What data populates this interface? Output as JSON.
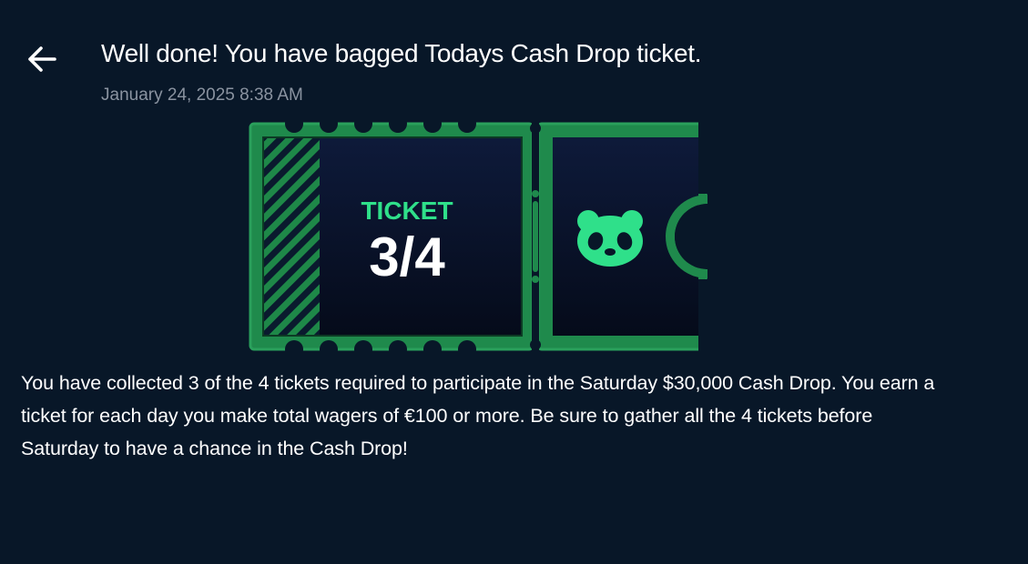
{
  "header": {
    "back_icon": "arrow-left-icon",
    "title": "Well done! You have bagged Todays Cash Drop ticket.",
    "timestamp": "January 24, 2025 8:38 AM"
  },
  "ticket": {
    "label": "TICKET",
    "progress": "3/4",
    "collected": 3,
    "required": 4,
    "mascot_icon": "panda-icon",
    "colors": {
      "frame": "#1f8a4c",
      "accent": "#2fe08a",
      "inner": "#0a1430"
    }
  },
  "message": {
    "body": "You have collected 3 of the 4 tickets required to participate in the Saturday $30,000 Cash Drop. You earn a ticket for each day you make total wagers of €100 or more. Be sure to gather all the 4 tickets before Saturday to have a chance in the Cash Drop!"
  }
}
